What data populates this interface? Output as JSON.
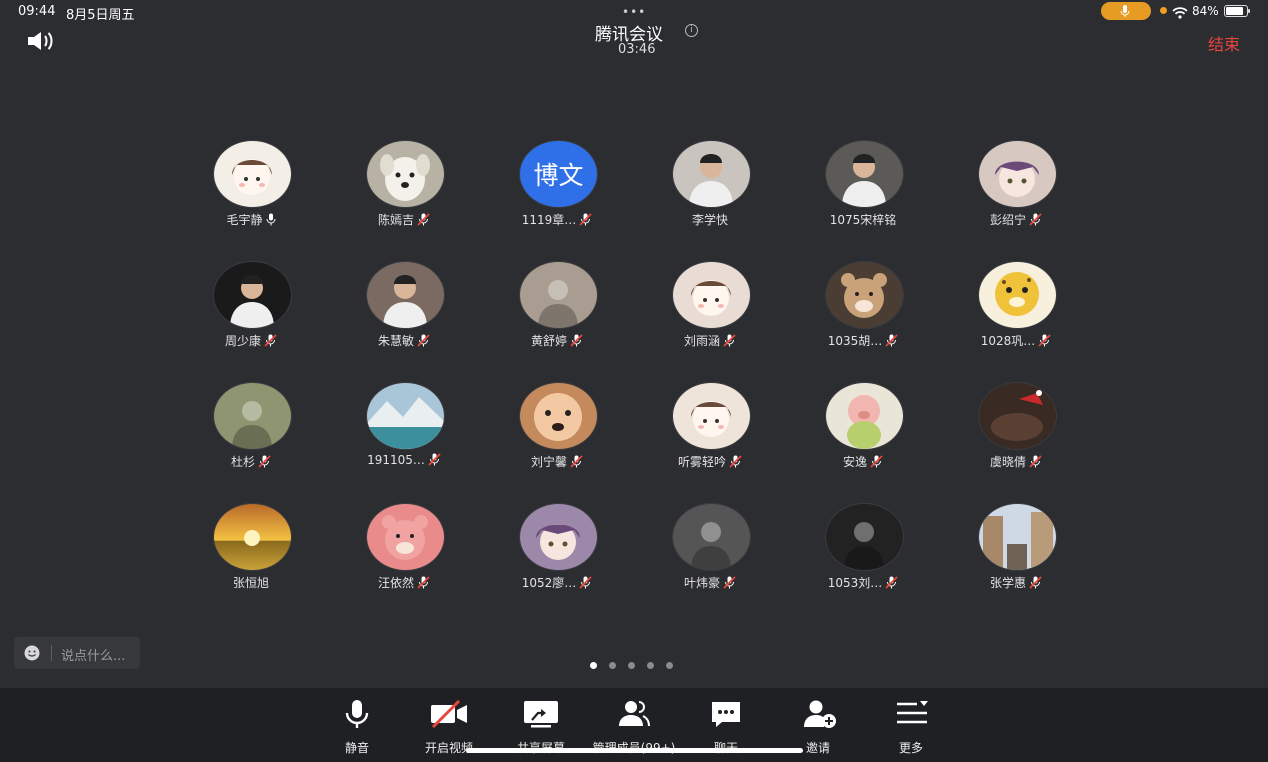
{
  "status_bar": {
    "time": "09:44",
    "date": "8月5日周五",
    "battery": "84%",
    "battery_level": 0.84
  },
  "header": {
    "title": "腾讯会议",
    "timer": "03:46",
    "end_label": "结束"
  },
  "participants": [
    {
      "name": "毛宇静",
      "mic": "on",
      "avatar": "cartoon-girl",
      "bg": "#f3eee6"
    },
    {
      "name": "陈嫣吉",
      "mic": "muted",
      "avatar": "dog",
      "bg": "#b8b2a4"
    },
    {
      "name": "1119章…",
      "mic": "muted",
      "avatar": "text",
      "avatar_text": "博文",
      "bg": "#2f6fe8"
    },
    {
      "name": "李学快",
      "mic": "none",
      "avatar": "person",
      "bg": "#c9c4bd"
    },
    {
      "name": "1075宋梓铭",
      "mic": "none",
      "avatar": "person",
      "bg": "#5c5a56"
    },
    {
      "name": "彭绍宁",
      "mic": "muted",
      "avatar": "anime",
      "bg": "#d8c8c2"
    },
    {
      "name": "周少康",
      "mic": "muted",
      "avatar": "person",
      "bg": "#1a1a1a"
    },
    {
      "name": "朱慧敏",
      "mic": "muted",
      "avatar": "person",
      "bg": "#7a6a62"
    },
    {
      "name": "黄舒婷",
      "mic": "muted",
      "avatar": "photo",
      "bg": "#a89d90"
    },
    {
      "name": "刘雨涵",
      "mic": "muted",
      "avatar": "cartoon-girl",
      "bg": "#e8dcd4"
    },
    {
      "name": "1035胡…",
      "mic": "muted",
      "avatar": "bear",
      "bg": "#4a3e34"
    },
    {
      "name": "1028巩…",
      "mic": "muted",
      "avatar": "leopard",
      "bg": "#f0c23a"
    },
    {
      "name": "杜杉",
      "mic": "muted",
      "avatar": "photo",
      "bg": "#8e9570"
    },
    {
      "name": "191105…",
      "mic": "muted",
      "avatar": "landscape",
      "bg": "#5f8ba0"
    },
    {
      "name": "刘宁馨",
      "mic": "muted",
      "avatar": "baby",
      "bg": "#c48a5c"
    },
    {
      "name": "听雾轻吟",
      "mic": "muted",
      "avatar": "cartoon-girl",
      "bg": "#efe4da"
    },
    {
      "name": "安逸",
      "mic": "muted",
      "avatar": "pig",
      "bg": "#e9e6d8"
    },
    {
      "name": "虞晓倩",
      "mic": "muted",
      "avatar": "cat",
      "bg": "#3a2a24"
    },
    {
      "name": "张恒旭",
      "mic": "none",
      "avatar": "sunset",
      "bg": "#e0a030"
    },
    {
      "name": "汪依然",
      "mic": "muted",
      "avatar": "bear",
      "bg": "#e98b8b"
    },
    {
      "name": "1052廖…",
      "mic": "muted",
      "avatar": "anime",
      "bg": "#9c88a8"
    },
    {
      "name": "叶炜豪",
      "mic": "muted",
      "avatar": "photo",
      "bg": "#555"
    },
    {
      "name": "1053刘…",
      "mic": "muted",
      "avatar": "photo",
      "bg": "#222"
    },
    {
      "name": "张学惠",
      "mic": "muted",
      "avatar": "street",
      "bg": "#8a7a60"
    }
  ],
  "chat": {
    "placeholder": "说点什么..."
  },
  "pagination": {
    "count": 5,
    "active": 0
  },
  "toolbar": {
    "items": [
      {
        "label": "静音",
        "icon": "microphone-icon"
      },
      {
        "label": "开启视频",
        "icon": "video-off-icon"
      },
      {
        "label": "共享屏幕",
        "icon": "share-screen-icon"
      },
      {
        "label": "管理成员(99+)",
        "icon": "members-icon"
      },
      {
        "label": "聊天",
        "icon": "chat-icon"
      },
      {
        "label": "邀请",
        "icon": "invite-icon"
      },
      {
        "label": "更多",
        "icon": "more-icon"
      }
    ]
  },
  "colors": {
    "background": "#2b2d31",
    "toolbar": "#1f2023",
    "end": "#e8453c",
    "accent_blue": "#2f6fe8",
    "mic_pill": "#e69b23"
  }
}
